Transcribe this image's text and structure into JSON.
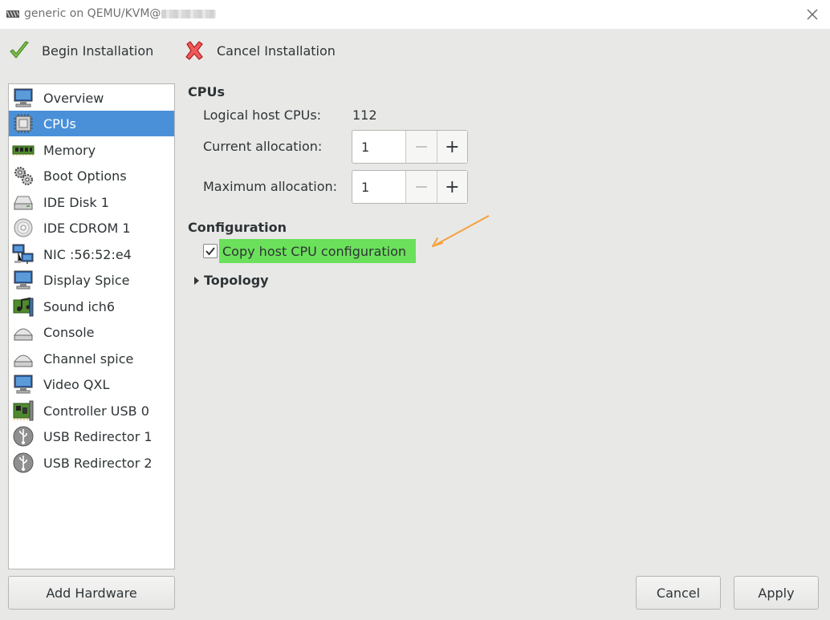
{
  "window": {
    "title": "generic on QEMU/KVM@"
  },
  "toolbar": {
    "begin_label": "Begin Installation",
    "cancel_label": "Cancel Installation"
  },
  "sidebar": {
    "items": [
      {
        "label": "Overview",
        "icon": "monitor-icon"
      },
      {
        "label": "CPUs",
        "icon": "cpu-icon",
        "selected": true
      },
      {
        "label": "Memory",
        "icon": "memory-icon"
      },
      {
        "label": "Boot Options",
        "icon": "gears-icon"
      },
      {
        "label": "IDE Disk 1",
        "icon": "disk-icon"
      },
      {
        "label": "IDE CDROM 1",
        "icon": "cdrom-icon"
      },
      {
        "label": "NIC :56:52:e4",
        "icon": "network-icon"
      },
      {
        "label": "Display Spice",
        "icon": "display-icon"
      },
      {
        "label": "Sound ich6",
        "icon": "sound-icon"
      },
      {
        "label": "Console",
        "icon": "console-icon"
      },
      {
        "label": "Channel spice",
        "icon": "channel-icon"
      },
      {
        "label": "Video QXL",
        "icon": "video-icon"
      },
      {
        "label": "Controller USB 0",
        "icon": "controller-icon"
      },
      {
        "label": "USB Redirector 1",
        "icon": "usb-icon"
      },
      {
        "label": "USB Redirector 2",
        "icon": "usb-icon"
      }
    ]
  },
  "cpus": {
    "heading": "CPUs",
    "logical_label": "Logical host CPUs:",
    "logical_value": "112",
    "current_label": "Current allocation:",
    "current_value": "1",
    "max_label": "Maximum allocation:",
    "max_value": "1",
    "minus_symbol": "−",
    "plus_symbol": "+"
  },
  "configuration": {
    "heading": "Configuration",
    "copy_host_label": "Copy host CPU configuration",
    "copy_host_checked": true
  },
  "topology": {
    "label": "Topology"
  },
  "footer": {
    "add_hardware": "Add Hardware",
    "cancel": "Cancel",
    "apply": "Apply"
  },
  "colors": {
    "selection": "#4a90d9",
    "highlight": "#6be05b",
    "arrow": "#f5a03c"
  }
}
